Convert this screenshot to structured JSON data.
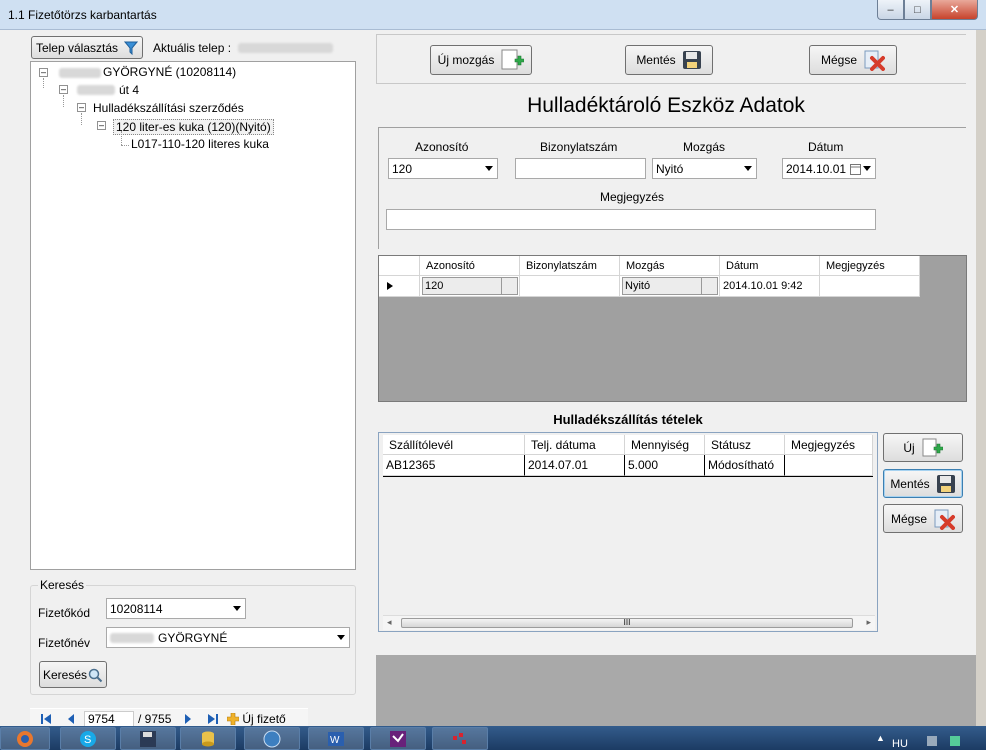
{
  "window": {
    "title": "1.1 Fizetőtörzs karbantartás",
    "min": "–",
    "max": "□",
    "close": "✕"
  },
  "left": {
    "site_button": "Telep választás",
    "current_site_label": "Aktuális telep :",
    "tree": {
      "n1": "GYÖRGYNÉ (10208114)",
      "n2": "út 4",
      "n3": "Hulladékszállítási szerződés",
      "n4": "120 liter-es kuka (120)(Nyitó)",
      "n5": "L017-110-120 literes kuka"
    },
    "search": {
      "group_label": "Keresés",
      "code_label": "Fizetőkód",
      "code_value": "10208114",
      "name_label": "Fizetőnév",
      "name_value": "GYÖRGYNÉ",
      "button": "Keresés"
    },
    "nav": {
      "current": "9754",
      "total": "/ 9755",
      "new_payer": "Új fizető"
    }
  },
  "toolbar": {
    "new_move": "Új mozgás",
    "save": "Mentés",
    "cancel": "Mégse"
  },
  "form": {
    "title": "Hulladéktároló Eszköz Adatok",
    "id_label": "Azonosító",
    "id_value": "120",
    "doc_label": "Bizonylatszám",
    "doc_value": "",
    "move_label": "Mozgás",
    "move_value": "Nyitó",
    "date_label": "Dátum",
    "date_value": "2014.10.01",
    "note_label": "Megjegyzés",
    "note_value": ""
  },
  "grid1": {
    "columns": [
      "Azonosító",
      "Bizonylatszám",
      "Mozgás",
      "Dátum",
      "Megjegyzés"
    ],
    "row": {
      "id": "120",
      "doc": "",
      "move": "Nyitó",
      "date": "2014.10.01 9:42",
      "note": ""
    }
  },
  "grid2": {
    "title": "Hulladékszállítás tételek",
    "columns": [
      "Szállítólevél",
      "Telj. dátuma",
      "Mennyiség",
      "Státusz",
      "Megjegyzés"
    ],
    "row": {
      "delivery": "AB12365",
      "date": "2014.07.01",
      "qty": "5.000",
      "status": "Módosítható",
      "note": ""
    },
    "scroll_thumb": "III"
  },
  "side_buttons": {
    "new": "Új",
    "save": "Mentés",
    "cancel": "Mégse"
  },
  "taskbar": {
    "lang": "HU"
  }
}
